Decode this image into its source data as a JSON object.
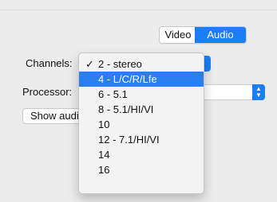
{
  "tabs": {
    "video_label": "Video",
    "audio_label": "Audio",
    "active": "Audio"
  },
  "labels": {
    "channels": "Channels:",
    "processor": "Processor:"
  },
  "buttons": {
    "show_audio": "Show audio"
  },
  "channels_menu": {
    "items": [
      {
        "label": "2 - stereo",
        "checked": true
      },
      {
        "label": "4 - L/C/R/Lfe",
        "highlighted": true
      },
      {
        "label": "6 - 5.1"
      },
      {
        "label": "8 - 5.1/HI/VI"
      },
      {
        "label": "10"
      },
      {
        "label": "12 - 7.1/HI/VI"
      },
      {
        "label": "14"
      },
      {
        "label": "16"
      }
    ],
    "check_glyph": "✓"
  },
  "colors": {
    "accent": "#1b7ef5",
    "panel_bg": "#ececec"
  }
}
